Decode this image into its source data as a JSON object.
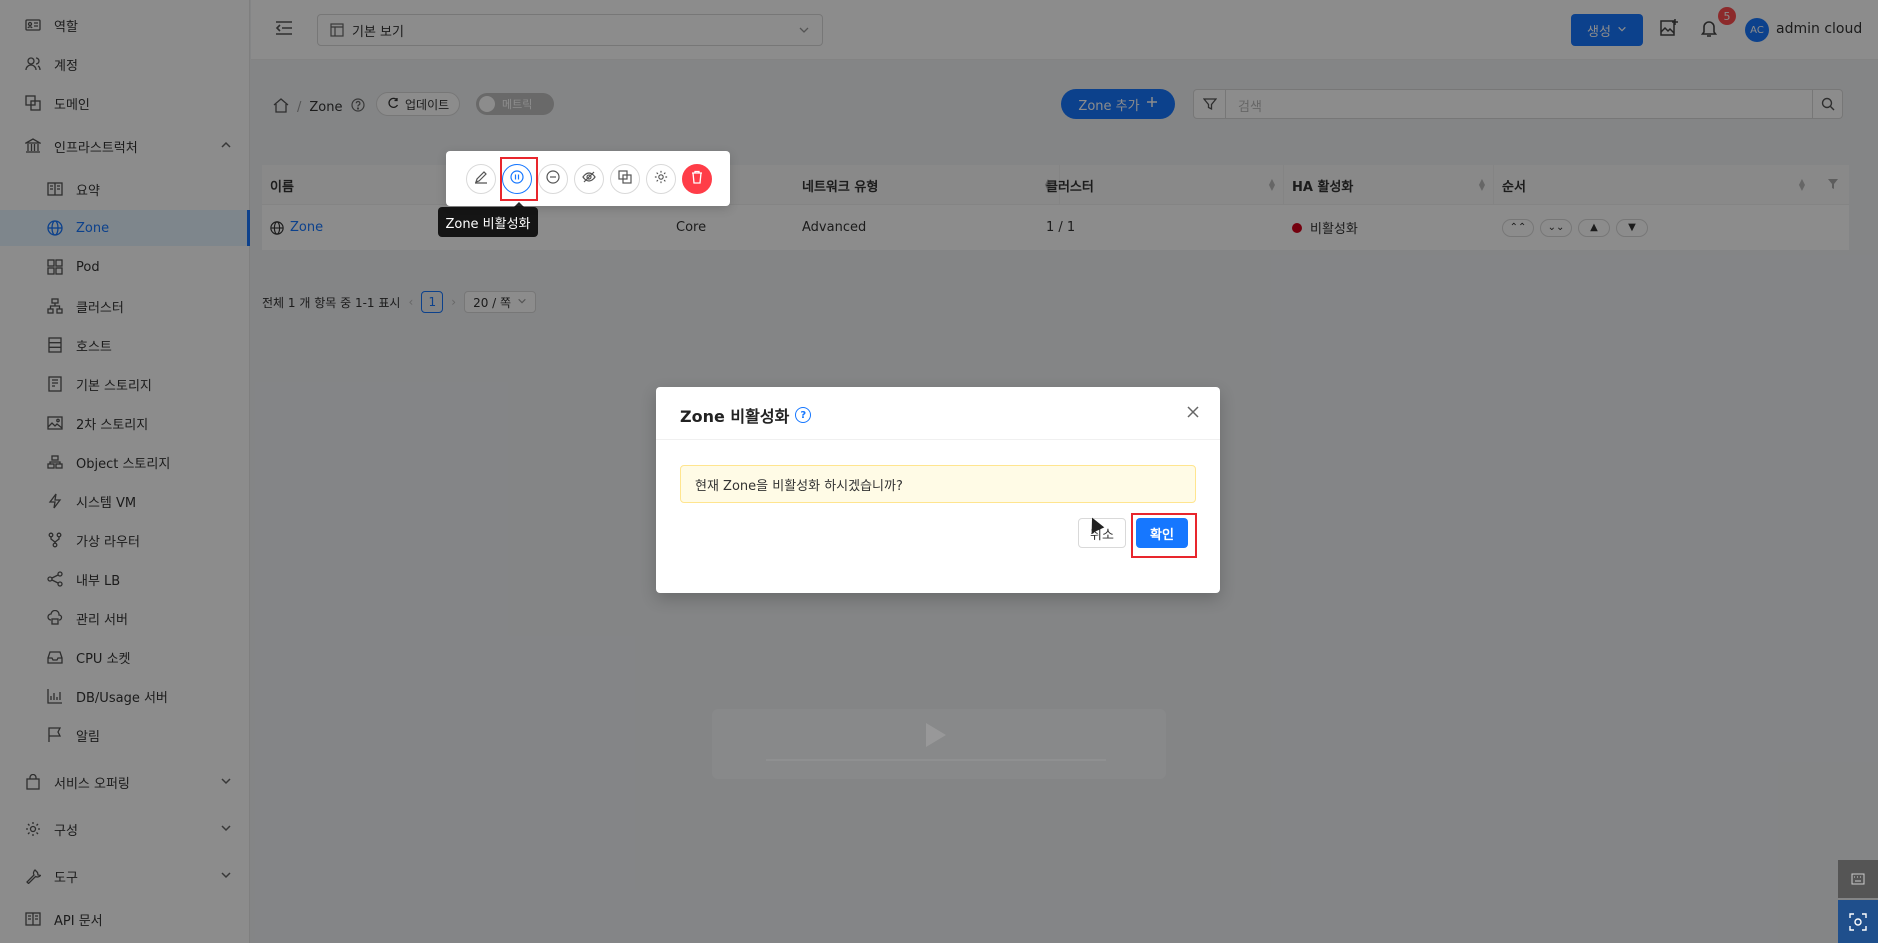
{
  "sidebar": {
    "items": [
      {
        "label": "역할",
        "icon": "id-card-icon"
      },
      {
        "label": "계정",
        "icon": "users-icon"
      },
      {
        "label": "도메인",
        "icon": "block-icon"
      },
      {
        "label": "인프라스트럭처",
        "icon": "bank-icon"
      },
      {
        "label": "요약",
        "icon": "read-icon"
      },
      {
        "label": "Zone",
        "icon": "globe-icon"
      },
      {
        "label": "Pod",
        "icon": "appstore-icon"
      },
      {
        "label": "클러스터",
        "icon": "cluster-icon"
      },
      {
        "label": "호스트",
        "icon": "database-icon"
      },
      {
        "label": "기본 스토리지",
        "icon": "hdd-icon"
      },
      {
        "label": "2차 스토리지",
        "icon": "picture-icon"
      },
      {
        "label": "Object 스토리지",
        "icon": "gold-icon"
      },
      {
        "label": "시스템 VM",
        "icon": "thunderbolt-icon"
      },
      {
        "label": "가상 라우터",
        "icon": "fork-icon"
      },
      {
        "label": "내부 LB",
        "icon": "share-icon"
      },
      {
        "label": "관리 서버",
        "icon": "cloud-server-icon"
      },
      {
        "label": "CPU 소켓",
        "icon": "inbox-icon"
      },
      {
        "label": "DB/Usage 서버",
        "icon": "bar-chart-icon"
      },
      {
        "label": "알림",
        "icon": "flag-icon"
      },
      {
        "label": "서비스 오퍼링",
        "icon": "shopping-icon"
      },
      {
        "label": "구성",
        "icon": "setting-icon"
      },
      {
        "label": "도구",
        "icon": "tool-icon"
      },
      {
        "label": "API 문서",
        "icon": "book-icon"
      }
    ]
  },
  "header": {
    "view_select": "기본 보기",
    "create_label": "생성",
    "notification_count": "5",
    "avatar_initials": "AC",
    "user_name": "admin cloud"
  },
  "page": {
    "breadcrumb_current": "Zone",
    "update_label": "업데이트",
    "metrics_label": "메트릭",
    "add_zone_label": "Zone 추가",
    "search_placeholder": "검색"
  },
  "table": {
    "columns": [
      "이름",
      "네트워크 유형",
      "클러스터",
      "HA 활성화",
      "순서"
    ],
    "rows": [
      {
        "name": "Zone",
        "type_prefix": "Core",
        "network_type": "Advanced",
        "clusters": "1 / 1",
        "ha": "비활성화"
      }
    ]
  },
  "pagination": {
    "summary": "전체 1 개 항목 중 1-1 표시",
    "page": "1",
    "page_size": "20 / 쪽"
  },
  "toolbar": {
    "tooltip": "Zone 비활성화"
  },
  "modal": {
    "title": "Zone 비활성화",
    "message": "현재 Zone을 비활성화 하시겠습니까?",
    "cancel_label": "취소",
    "ok_label": "확인"
  },
  "colors": {
    "primary": "#1677ff",
    "danger": "#ff3d48",
    "highlight_frame": "#e8262d",
    "ha_disabled": "#d4001a"
  }
}
